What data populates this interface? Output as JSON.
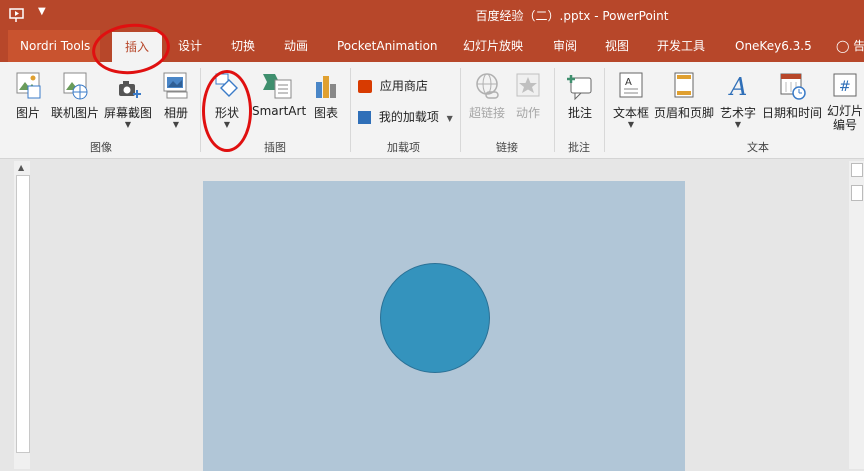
{
  "window": {
    "title": "百度经验（二）.pptx - PowerPoint"
  },
  "tabs": [
    {
      "label": "Nordri Tools"
    },
    {
      "label": "插入"
    },
    {
      "label": "设计"
    },
    {
      "label": "切换"
    },
    {
      "label": "动画"
    },
    {
      "label": "PocketAnimation"
    },
    {
      "label": "幻灯片放映"
    },
    {
      "label": "审阅"
    },
    {
      "label": "视图"
    },
    {
      "label": "开发工具"
    },
    {
      "label": "OneKey6.3.5"
    },
    {
      "label": "告"
    }
  ],
  "ribbon": {
    "images": {
      "label": "图像",
      "picture": "图片",
      "online_picture": "联机图片",
      "screenshot": "屏幕截图",
      "album": "相册"
    },
    "illustrations": {
      "label": "插图",
      "shapes": "形状",
      "smartart": "SmartArt",
      "chart": "图表"
    },
    "addins": {
      "label": "加载项",
      "store": "应用商店",
      "my_addins": "我的加载项"
    },
    "links": {
      "label": "链接",
      "hyperlink": "超链接",
      "action": "动作"
    },
    "comments": {
      "label": "批注",
      "comment": "批注"
    },
    "text": {
      "label": "文本",
      "textbox": "文本框",
      "header_footer": "页眉和页脚",
      "wordart": "艺术字",
      "datetime": "日期和时间",
      "slide_number": "幻灯片编号"
    }
  },
  "colors": {
    "accent": "#b7472a",
    "slide_bg": "#b1c6d7",
    "shape_fill": "#3493bd",
    "annotation": "#e01010"
  }
}
